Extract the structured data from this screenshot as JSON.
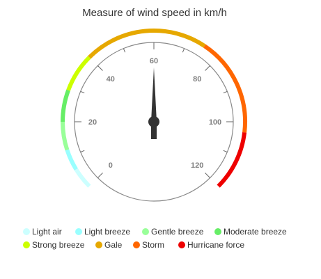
{
  "chart_data": {
    "type": "gauge",
    "title": "Measure of wind speed in km/h",
    "value": 60,
    "scale": {
      "min": 0,
      "max": 120,
      "major_ticks": [
        0,
        20,
        40,
        60,
        80,
        100,
        120
      ]
    },
    "ranges": [
      {
        "name": "Light air",
        "from": 0,
        "to": 6,
        "color": "#ccffff"
      },
      {
        "name": "Light breeze",
        "from": 6,
        "to": 12,
        "color": "#99ffff"
      },
      {
        "name": "Gentle breeze",
        "from": 12,
        "to": 20,
        "color": "#99ff99"
      },
      {
        "name": "Moderate breeze",
        "from": 20,
        "to": 29,
        "color": "#66ee66"
      },
      {
        "name": "Strong breeze",
        "from": 29,
        "to": 40,
        "color": "#ccff00"
      },
      {
        "name": "Gale",
        "from": 40,
        "to": 75,
        "color": "#e6a800"
      },
      {
        "name": "Storm",
        "from": 75,
        "to": 103,
        "color": "#ff6600"
      },
      {
        "name": "Hurricane force",
        "from": 103,
        "to": 120,
        "color": "#ee0000"
      }
    ]
  }
}
